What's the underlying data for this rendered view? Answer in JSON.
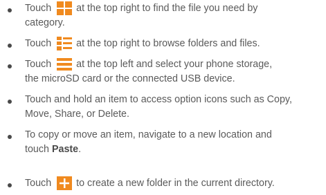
{
  "items": [
    {
      "pre": "Touch",
      "icon": "grid-category-icon",
      "post_line1": "at the top right to find the file you need by",
      "line2": "category."
    },
    {
      "pre": "Touch",
      "icon": "list-folders-icon",
      "post_line1": "at the top right to browse folders and files."
    },
    {
      "pre": "Touch",
      "icon": "menu-icon",
      "post_line1": "at the top left and select your phone storage,",
      "line2": "the microSD card or the connected USB device."
    },
    {
      "line1": "Touch and hold an item to access option icons such as Copy,",
      "line2": "Move, Share, or Delete."
    },
    {
      "line1": "To copy or move an item, navigate to a new location and",
      "line2_pre": "touch ",
      "line2_bold": "Paste",
      "line2_post": "."
    },
    {
      "pre": "Touch",
      "icon": "add-folder-icon",
      "post_line1": "to create a new folder in the current directory."
    }
  ],
  "colors": {
    "icon_orange": "#f08a1f",
    "text": "#5a5a5a",
    "bullet": "#4a4a4a"
  }
}
